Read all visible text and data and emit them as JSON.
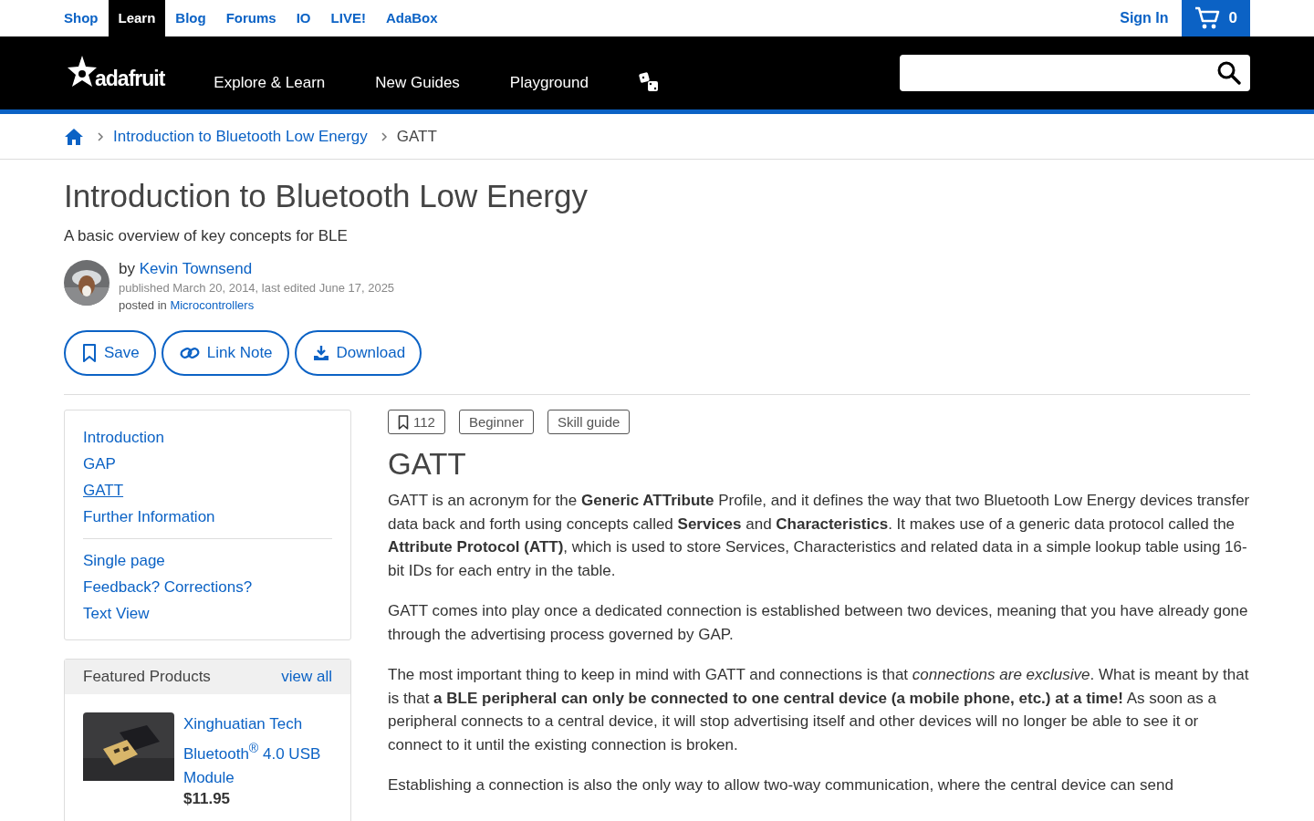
{
  "top_nav": {
    "links": [
      {
        "label": "Shop",
        "selected": false
      },
      {
        "label": "Learn",
        "selected": true
      },
      {
        "label": "Blog",
        "selected": false
      },
      {
        "label": "Forums",
        "selected": false
      },
      {
        "label": "IO",
        "selected": false
      },
      {
        "label": "LIVE!",
        "selected": false
      },
      {
        "label": "AdaBox",
        "selected": false
      }
    ],
    "sign_in": "Sign In",
    "cart_count": "0"
  },
  "main_nav": {
    "logo": "adafruit",
    "items": [
      "Explore & Learn",
      "New Guides",
      "Playground"
    ]
  },
  "breadcrumb": {
    "items": [
      "Introduction to Bluetooth Low Energy"
    ],
    "current": "GATT"
  },
  "guide": {
    "title": "Introduction to Bluetooth Low Energy",
    "subtitle": "A basic overview of key concepts for BLE",
    "byline": "by",
    "author": "Kevin Townsend",
    "published": "published March 20, 2014, last edited June 17, 2025",
    "posted_in": "posted in",
    "category": "Microcontrollers",
    "actions": [
      {
        "label": "Save",
        "kind": "bookmark"
      },
      {
        "label": "Link Note",
        "kind": "link"
      },
      {
        "label": "Download",
        "kind": "download"
      }
    ]
  },
  "sidebar": {
    "pages": [
      {
        "label": "Introduction",
        "selected": false
      },
      {
        "label": "GAP",
        "selected": false
      },
      {
        "label": "GATT",
        "selected": true
      },
      {
        "label": "Further Information",
        "selected": false
      }
    ],
    "links": [
      "Single page",
      "Feedback? Corrections?",
      "Text View"
    ],
    "featured": {
      "title": "Featured Products",
      "view_all": "view all",
      "products": [
        {
          "name": "Xinghuatian Tech Bluetooth$^{®}$ 4.0 USB Module",
          "price": "$11.95"
        }
      ]
    }
  },
  "content": {
    "tags": [
      {
        "label": "112",
        "kind": "saves"
      },
      {
        "label": "Beginner",
        "kind": "tag"
      },
      {
        "label": "Skill guide",
        "kind": "tag"
      }
    ],
    "heading": "GATT",
    "paragraphs": [
      "GATT is an acronym for the **Generic ATTribute** Profile, and it defines the way that two Bluetooth Low Energy devices transfer data back and forth using concepts called **Services** and **Characteristics**. It makes use of a generic data protocol called the **Attribute Protocol (ATT)**, which is used to store Services, Characteristics and related data in a simple lookup table using 16-bit IDs for each entry in the table.",
      "GATT comes into play once a dedicated connection is established between two devices, meaning that you have already gone through the advertising process governed by GAP.",
      "The most important thing to keep in mind with GATT and connections is that *connections are exclusive*. What is meant by that is that **a BLE peripheral can only be connected to one central device (a mobile phone, etc.) at a time!** As soon as a peripheral connects to a central device, it will stop advertising itself and other devices will no longer be able to see it or connect to it until the existing connection is broken.",
      "Establishing a connection is also the only way to allow two-way communication, where the central device can send"
    ]
  }
}
